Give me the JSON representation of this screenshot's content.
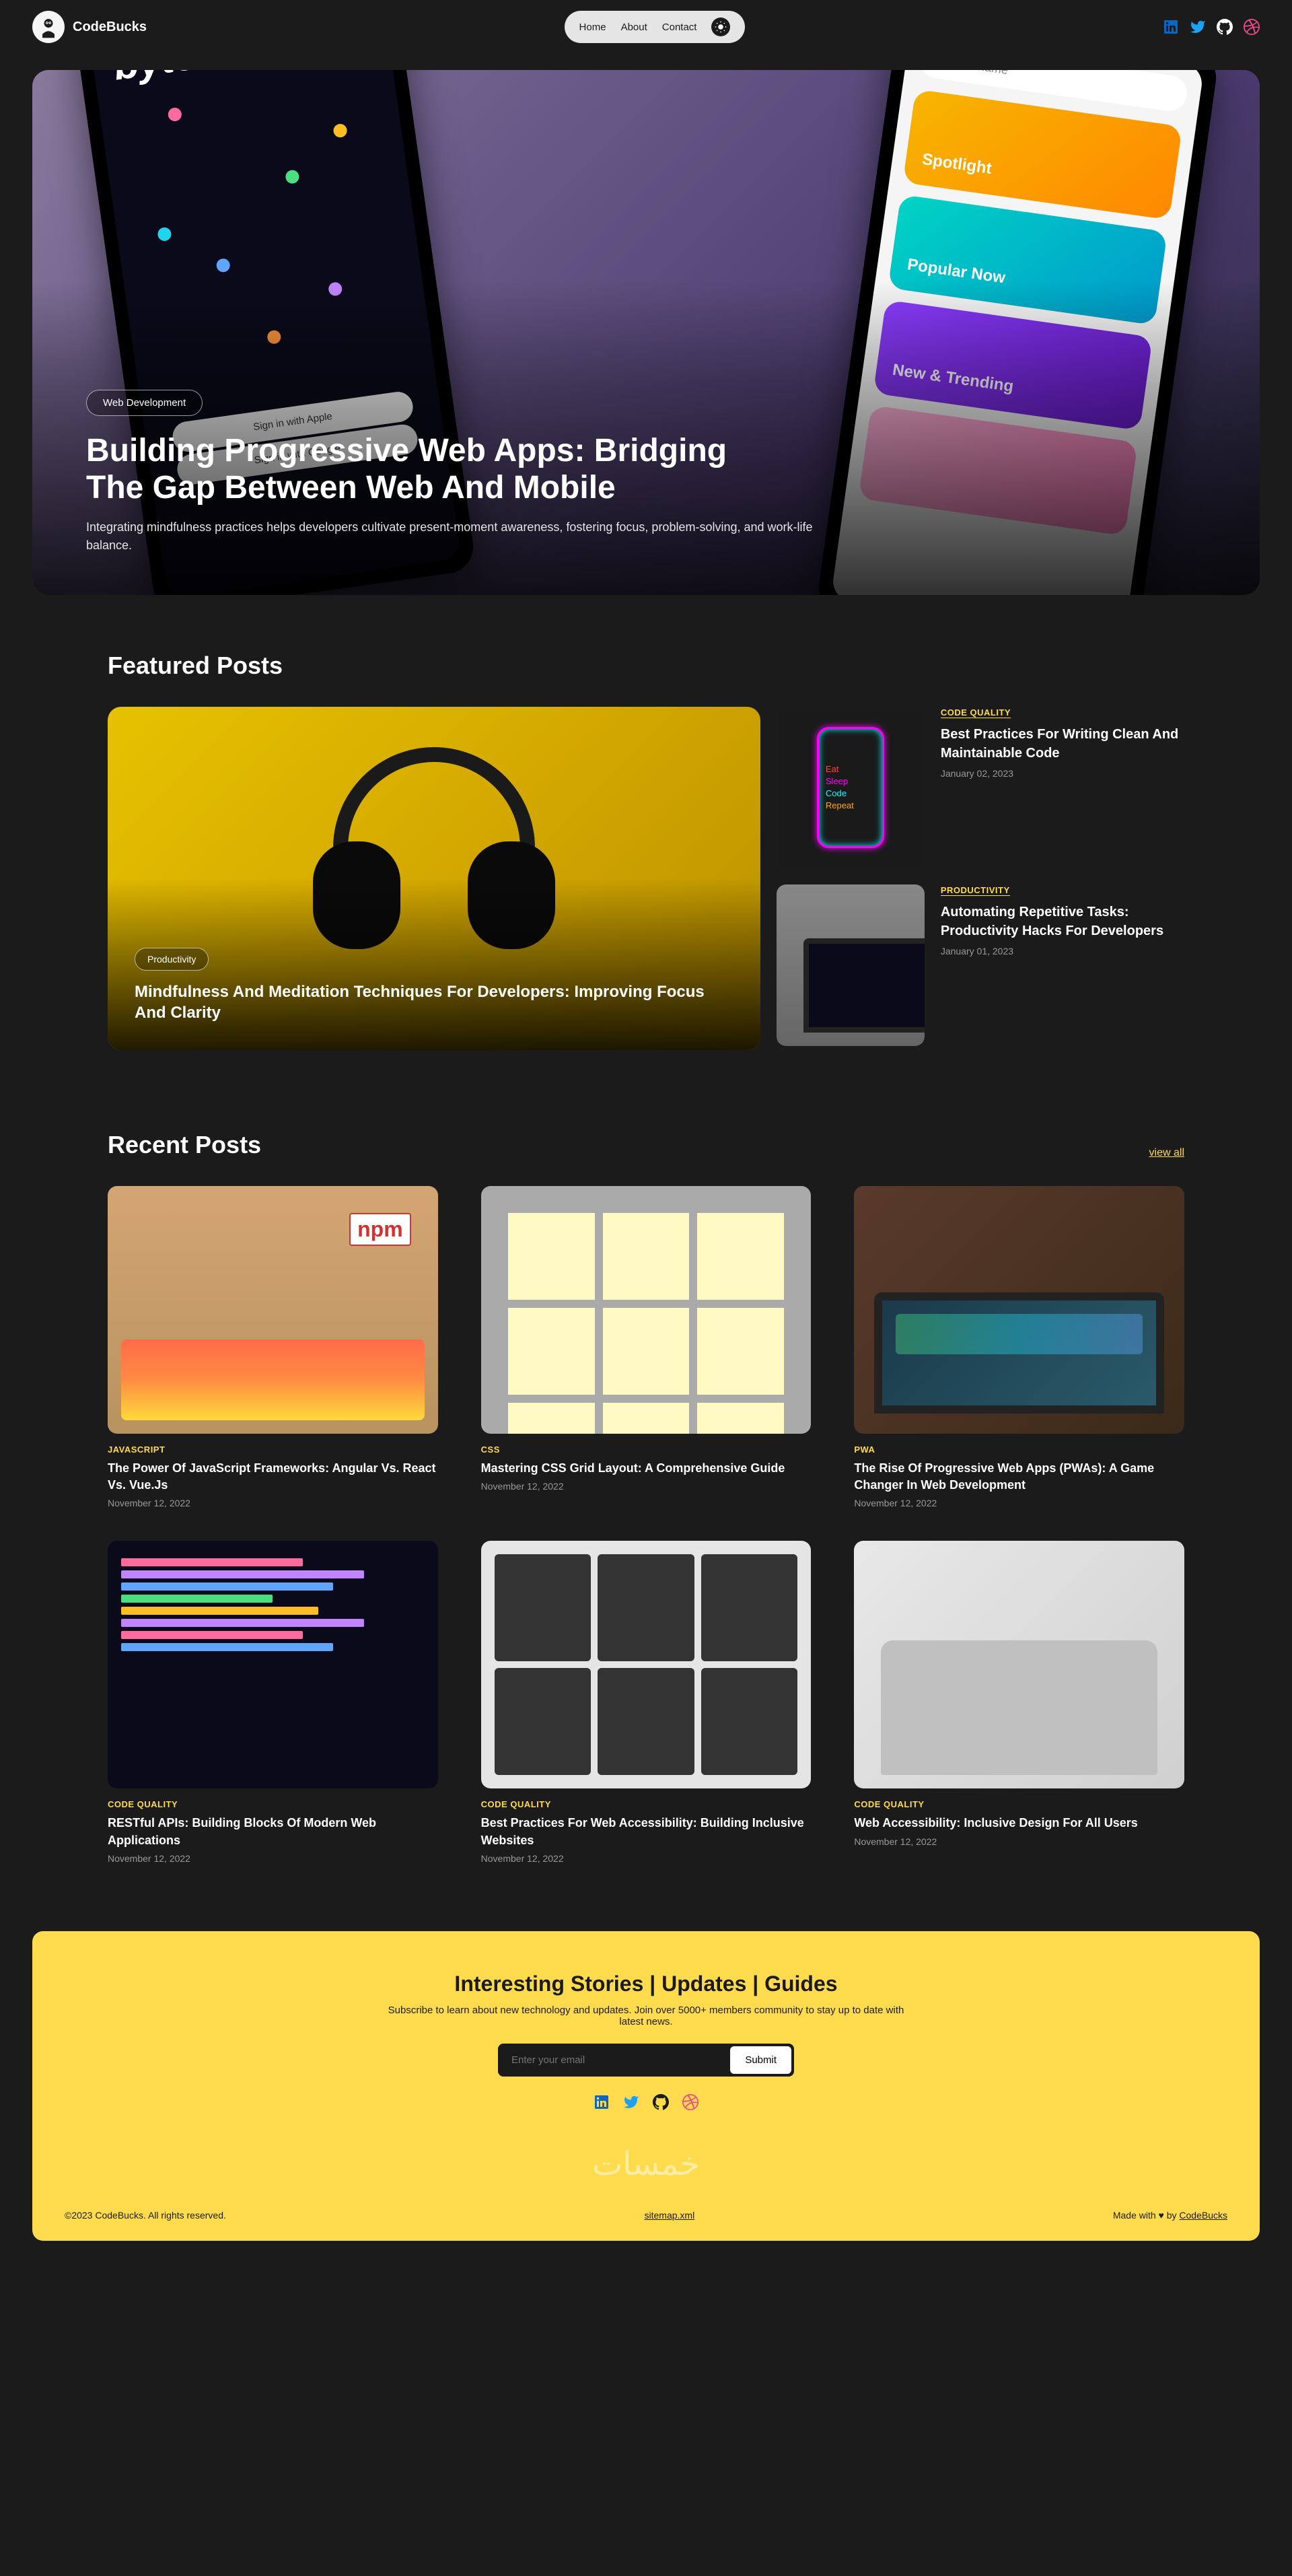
{
  "brand": {
    "name": "CodeBucks"
  },
  "nav": {
    "home": "Home",
    "about": "About",
    "contact": "Contact"
  },
  "hero": {
    "tag": "Web Development",
    "title": "Building Progressive Web Apps: Bridging The Gap Between Web And Mobile",
    "desc": "Integrating mindfulness practices helps developers cultivate present-moment awareness, fostering focus, problem-solving, and work-life balance.",
    "phone_left": {
      "logo": "byte",
      "signin_apple": "Sign in with Apple",
      "signin_google": "Sign in with Google"
    },
    "phone_right": {
      "search_placeholder": "username",
      "cards": [
        "Spotlight",
        "Popular Now",
        "New & Trending"
      ]
    }
  },
  "featured": {
    "heading": "Featured Posts",
    "big": {
      "tag": "Productivity",
      "title": "Mindfulness And Meditation Techniques For Developers: Improving Focus And Clarity"
    },
    "side": [
      {
        "cat": "CODE QUALITY",
        "title": "Best Practices For Writing Clean And Maintainable Code",
        "date": "January 02, 2023",
        "neon": {
          "eat": "Eat",
          "sleep": "Sleep",
          "code": "Code",
          "repeat": "Repeat"
        }
      },
      {
        "cat": "PRODUCTIVITY",
        "title": "Automating Repetitive Tasks: Productivity Hacks For Developers",
        "date": "January 01, 2023"
      }
    ]
  },
  "recent": {
    "heading": "Recent Posts",
    "view_all": "view all",
    "posts": [
      {
        "cat": "JAVASCRIPT",
        "title": "The Power Of JavaScript Frameworks: Angular Vs. React Vs. Vue.Js",
        "date": "November 12, 2022",
        "npm": "npm"
      },
      {
        "cat": "CSS",
        "title": "Mastering CSS Grid Layout: A Comprehensive Guide",
        "date": "November 12, 2022"
      },
      {
        "cat": "PWA",
        "title": "The Rise Of Progressive Web Apps (PWAs): A Game Changer In Web Development",
        "date": "November 12, 2022"
      },
      {
        "cat": "CODE QUALITY",
        "title": "RESTful APIs: Building Blocks Of Modern Web Applications",
        "date": "November 12, 2022"
      },
      {
        "cat": "CODE QUALITY",
        "title": "Best Practices For Web Accessibility: Building Inclusive Websites",
        "date": "November 12, 2022"
      },
      {
        "cat": "CODE QUALITY",
        "title": "Web Accessibility: Inclusive Design For All Users",
        "date": "November 12, 2022"
      }
    ]
  },
  "footer": {
    "heading": "Interesting Stories | Updates | Guides",
    "sub": "Subscribe to learn about new technology and updates. Join over 5000+ members community to stay up to date with latest news.",
    "email_placeholder": "Enter your email",
    "submit": "Submit",
    "watermark": "خمسات",
    "copyright": "©2023 CodeBucks. All rights reserved.",
    "sitemap": "sitemap.xml",
    "made_prefix": "Made with ♥ by ",
    "made_link": "CodeBucks"
  }
}
